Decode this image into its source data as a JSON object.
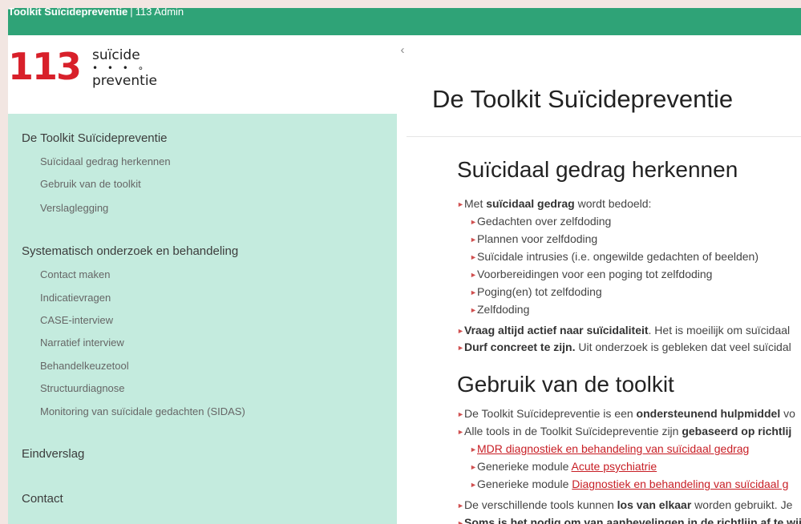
{
  "topbar": {
    "brand": "Toolkit Suïcidepreventie",
    "separator": "|",
    "admin": "113 Admin"
  },
  "logo": {
    "digits": "113",
    "word1": "suïcide",
    "dots": "• • • ∘",
    "word2": "preventie"
  },
  "collapse": {
    "icon": "‹"
  },
  "nav": {
    "group1": {
      "title": "De Toolkit Suïcidepreventie",
      "items": [
        "Suïcidaal gedrag herkennen",
        "Gebruik van de toolkit",
        "Verslaglegging"
      ]
    },
    "group2": {
      "title": "Systematisch onderzoek en behandeling",
      "items": [
        "Contact maken",
        "Indicatievragen",
        "CASE-interview",
        "Narratief interview",
        "Behandelkeuzetool",
        "Structuurdiagnose",
        "Monitoring van suïcidale gedachten (SIDAS)"
      ]
    },
    "group3": {
      "title": "Eindverslag"
    },
    "group4": {
      "title": "Contact"
    }
  },
  "content": {
    "page_title": "De Toolkit Suïcidepreventie",
    "bullet": "►",
    "section1": {
      "heading": "Suïcidaal gedrag herkennen",
      "intro_prefix": "Met ",
      "intro_bold": "suïcidaal gedrag",
      "intro_suffix": " wordt bedoeld:",
      "list": [
        "Gedachten over zelfdoding",
        "Plannen voor zelfdoding",
        "Suïcidale intrusies (i.e. ongewilde gedachten of beelden)",
        "Voorbereidingen voor een poging tot zelfdoding",
        "Poging(en) tot zelfdoding",
        "Zelfdoding"
      ],
      "p1_bold": "Vraag altijd actief naar suïcidaliteit",
      "p1_rest": ". Het is moeilijk om suïcidaal",
      "p2_bold": "Durf concreet te zijn.",
      "p2_rest": " Uit onderzoek is gebleken dat veel suïcidal"
    },
    "section2": {
      "heading": "Gebruik van de toolkit",
      "p1_prefix": "De Toolkit Suïcidepreventie is een ",
      "p1_bold": "ondersteunend hulpmiddel",
      "p1_rest": " vo",
      "p2_prefix": "Alle tools in de Toolkit Suïcidepreventie zijn ",
      "p2_bold": "gebaseerd op richtlij",
      "link1": "MDR diagnostiek en behandeling van suïcidaal gedrag",
      "link2_prefix": "Generieke module ",
      "link2": "Acute psychiatrie",
      "link3_prefix": "Generieke module ",
      "link3": "Diagnostiek en behandeling van suïcidaal g",
      "p3_prefix": "De verschillende tools kunnen ",
      "p3_bold": "los van elkaar",
      "p3_rest": " worden gebruikt. Je",
      "p4_bold": "Soms is het nodig om van aanbevelingen in de richtlijn af te wijk"
    }
  }
}
